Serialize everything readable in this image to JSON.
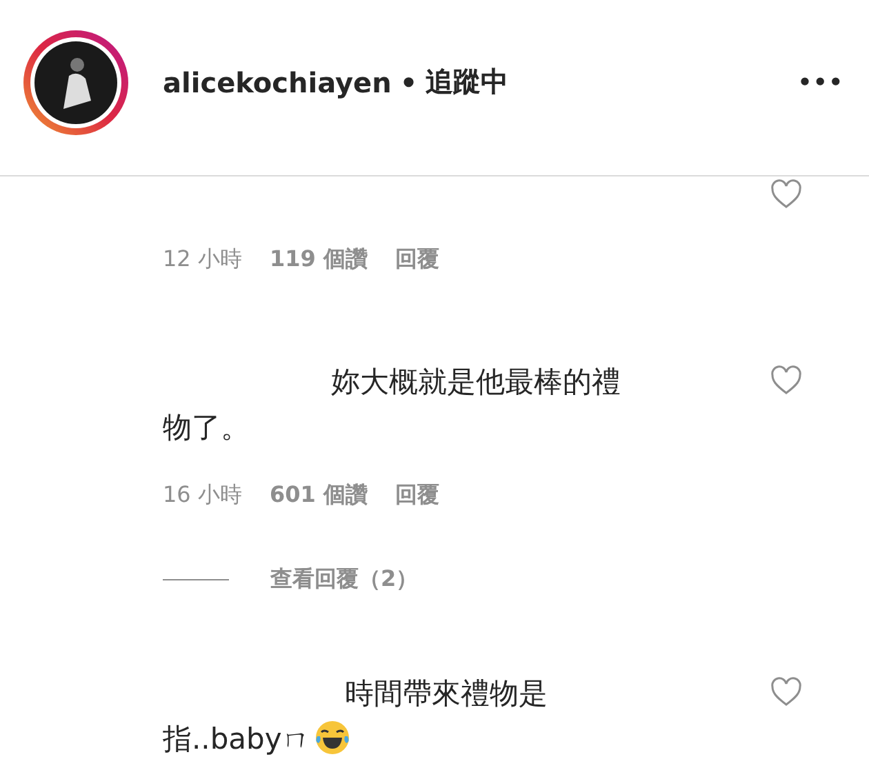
{
  "header": {
    "username": "alicekochiayen",
    "separator": "•",
    "follow_status": "追蹤中",
    "more": "•••"
  },
  "comments": [
    {
      "meta": {
        "time": "12 小時",
        "likes": "119 個讚",
        "reply": "回覆"
      }
    },
    {
      "text_lines": [
        "妳大概就是他最棒的禮",
        "物了。"
      ],
      "meta": {
        "time": "16 小時",
        "likes": "601 個讚",
        "reply": "回覆"
      },
      "view_replies": "查看回覆（2）"
    },
    {
      "text_lines": [
        "時間帶來禮物是",
        "指..babyㄇ"
      ],
      "emoji": true
    }
  ]
}
